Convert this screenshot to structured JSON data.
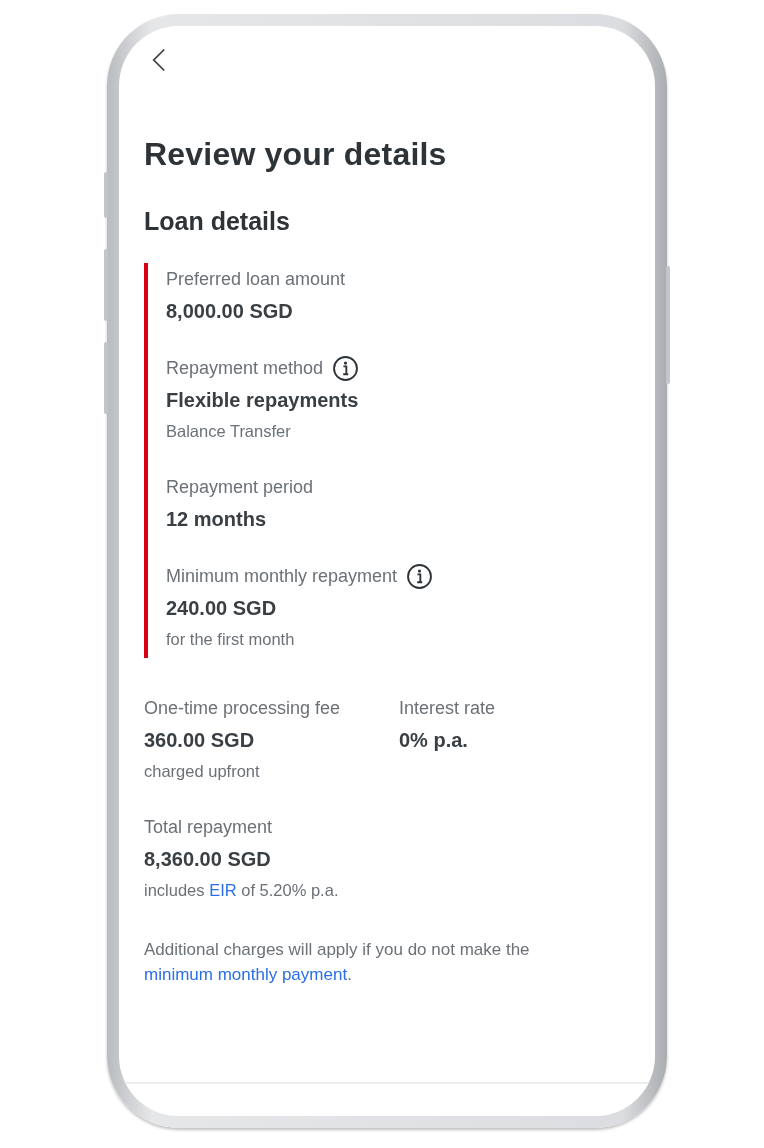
{
  "title": "Review your details",
  "section_title": "Loan details",
  "loan_details": [
    {
      "label": "Preferred loan amount",
      "info": false,
      "value": "8,000.00 SGD"
    },
    {
      "label": "Repayment method",
      "info": true,
      "value": "Flexible repayments",
      "note": [
        {
          "kind": "text",
          "text": "Balance Transfer"
        }
      ]
    },
    {
      "label": "Repayment period",
      "info": false,
      "value": "12 months"
    },
    {
      "label": "Minimum monthly repayment",
      "info": true,
      "value": "240.00 SGD",
      "note": [
        {
          "kind": "text",
          "text": "for the first month"
        }
      ]
    }
  ],
  "fees": [
    {
      "label": "One-time processing fee",
      "info": false,
      "value": "360.00 SGD",
      "note": [
        {
          "kind": "text",
          "text": "charged upfront"
        }
      ]
    },
    {
      "label": "Interest rate",
      "info": false,
      "value": "0% p.a."
    },
    {
      "label": "Total repayment",
      "info": false,
      "value": "8,360.00 SGD",
      "note": [
        {
          "kind": "text",
          "text": "includes "
        },
        {
          "kind": "link",
          "text": "EIR"
        },
        {
          "kind": "text",
          "text": " of 5.20% p.a."
        }
      ]
    }
  ],
  "disclaimer": [
    {
      "kind": "text",
      "text": "Additional charges will apply if you do not make the "
    },
    {
      "kind": "link",
      "text": "minimum monthly payment"
    },
    {
      "kind": "text",
      "text": "."
    }
  ]
}
